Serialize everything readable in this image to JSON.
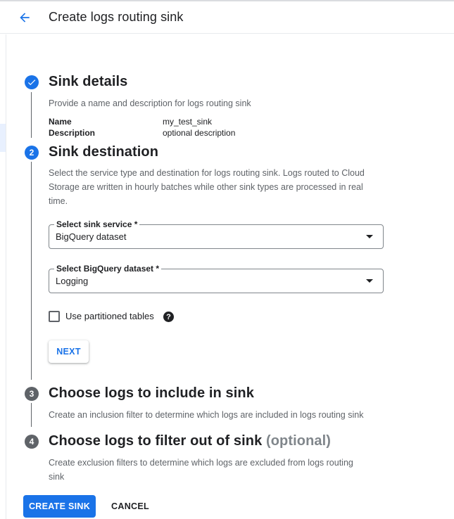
{
  "header": {
    "title": "Create logs routing sink",
    "back_icon": "arrow-back-icon"
  },
  "steps": [
    {
      "number": "1",
      "title": "Sink details",
      "description": "Provide a name and description for logs routing sink",
      "fields": [
        {
          "label": "Name",
          "value": "my_test_sink"
        },
        {
          "label": "Description",
          "value": "optional description"
        }
      ]
    },
    {
      "number": "2",
      "title": "Sink destination",
      "description_lines": [
        "Select the service type and destination for logs routing sink. Logs routed to Cloud",
        "Storage are written in hourly batches while other sink types are processed in real",
        "time."
      ],
      "sink_service": {
        "label": "Select sink service *",
        "value": "BigQuery dataset"
      },
      "dataset": {
        "label": "Select BigQuery dataset *",
        "value": "Logging"
      },
      "partitioned": {
        "label": "Use partitioned tables",
        "checked": false
      },
      "next_label": "NEXT"
    },
    {
      "number": "3",
      "title": "Choose logs to include in sink",
      "description": "Create an inclusion filter to determine which logs are included in logs routing sink"
    },
    {
      "number": "4",
      "title": "Choose logs to filter out of sink",
      "optional": "(optional)",
      "description_lines": [
        "Create exclusion filters to determine which logs are excluded from logs routing",
        "sink"
      ]
    }
  ],
  "actions": {
    "create_label": "CREATE SINK",
    "cancel_label": "CANCEL"
  },
  "colors": {
    "accent": "#1a73e8",
    "inactive_step": "#5f6368"
  }
}
